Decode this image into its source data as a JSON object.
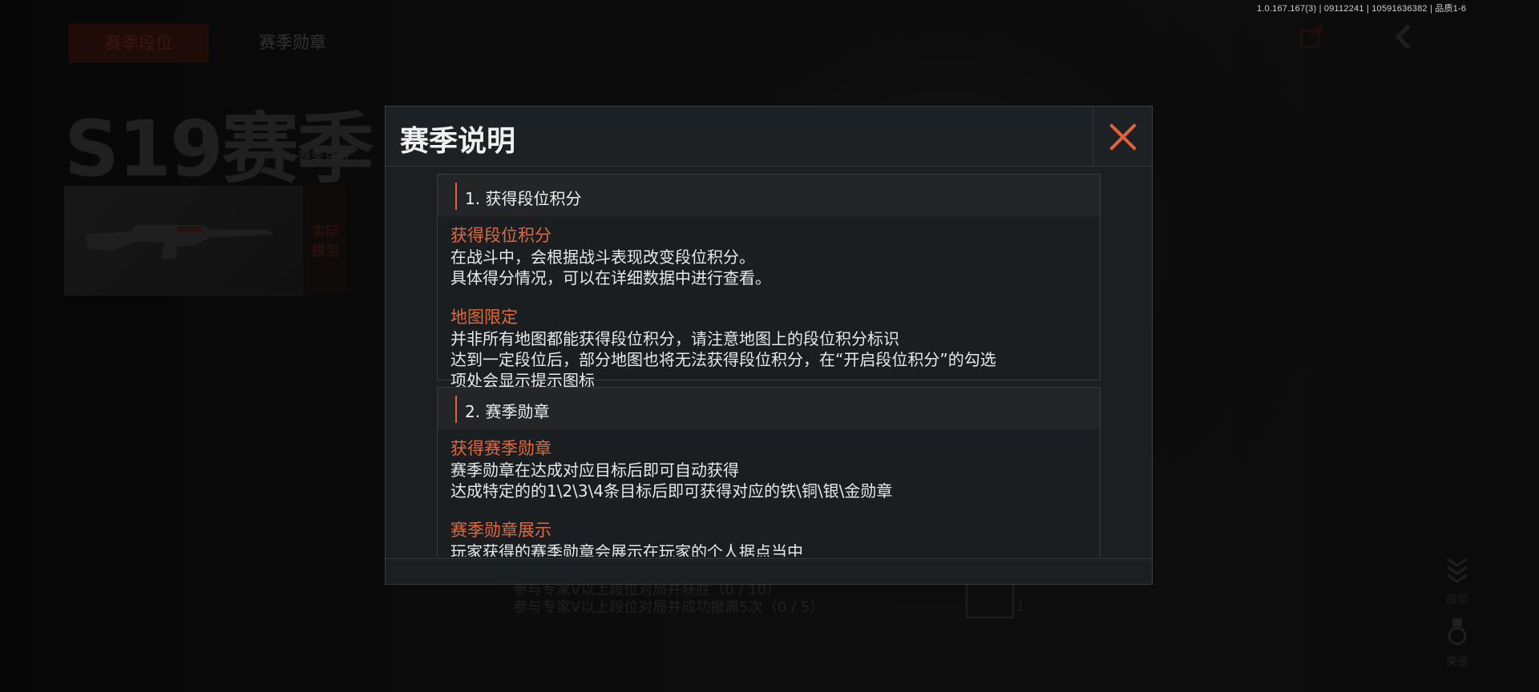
{
  "version": "1.0.167.167(3) | 09112241 | 10591636382 | 品质1-6",
  "tabs": {
    "ranked": "赛季段位",
    "medals": "赛季勋章"
  },
  "season": {
    "title": "S19赛季",
    "subtitle": "赛季总览"
  },
  "weapon_tag": "实际\n模型",
  "tasks": [
    "参与专家V以上段位对局并获胜（0 / 10）",
    "参与专家V以上段位对局并成功撤离5次（0 / 5）"
  ],
  "task_count": "1",
  "side_buttons": {
    "rank": "段位",
    "glory": "荣誉"
  },
  "dialog": {
    "title": "赛季说明",
    "sections": [
      {
        "header": "1. 获得段位积分",
        "blocks": [
          {
            "subtitle": "获得段位积分",
            "lines": [
              "在战斗中，会根据战斗表现改变段位积分。",
              "具体得分情况，可以在详细数据中进行查看。"
            ]
          },
          {
            "subtitle": "地图限定",
            "lines": [
              "并非所有地图都能获得段位积分，请注意地图上的段位积分标识",
              "达到一定段位后，部分地图也将无法获得段位积分，在“开启段位积分”的勾选",
              "项处会显示提示图标"
            ]
          }
        ]
      },
      {
        "header": "2. 赛季勋章",
        "blocks": [
          {
            "subtitle": "获得赛季勋章",
            "lines": [
              "赛季勋章在达成对应目标后即可自动获得",
              "达成特定的的1\\2\\3\\4条目标后即可获得对应的铁\\铜\\银\\金勋章"
            ]
          },
          {
            "subtitle": "赛季勋章展示",
            "lines": [
              "玩家获得的赛季勋章会展示在玩家的个人据点当中"
            ]
          }
        ]
      }
    ]
  },
  "colors": {
    "accent": "#e0643a",
    "panel": "#1c1f21",
    "text": "#e8e8e8"
  },
  "icons": {
    "close": "close-icon",
    "share": "share-icon",
    "back": "back-icon"
  }
}
